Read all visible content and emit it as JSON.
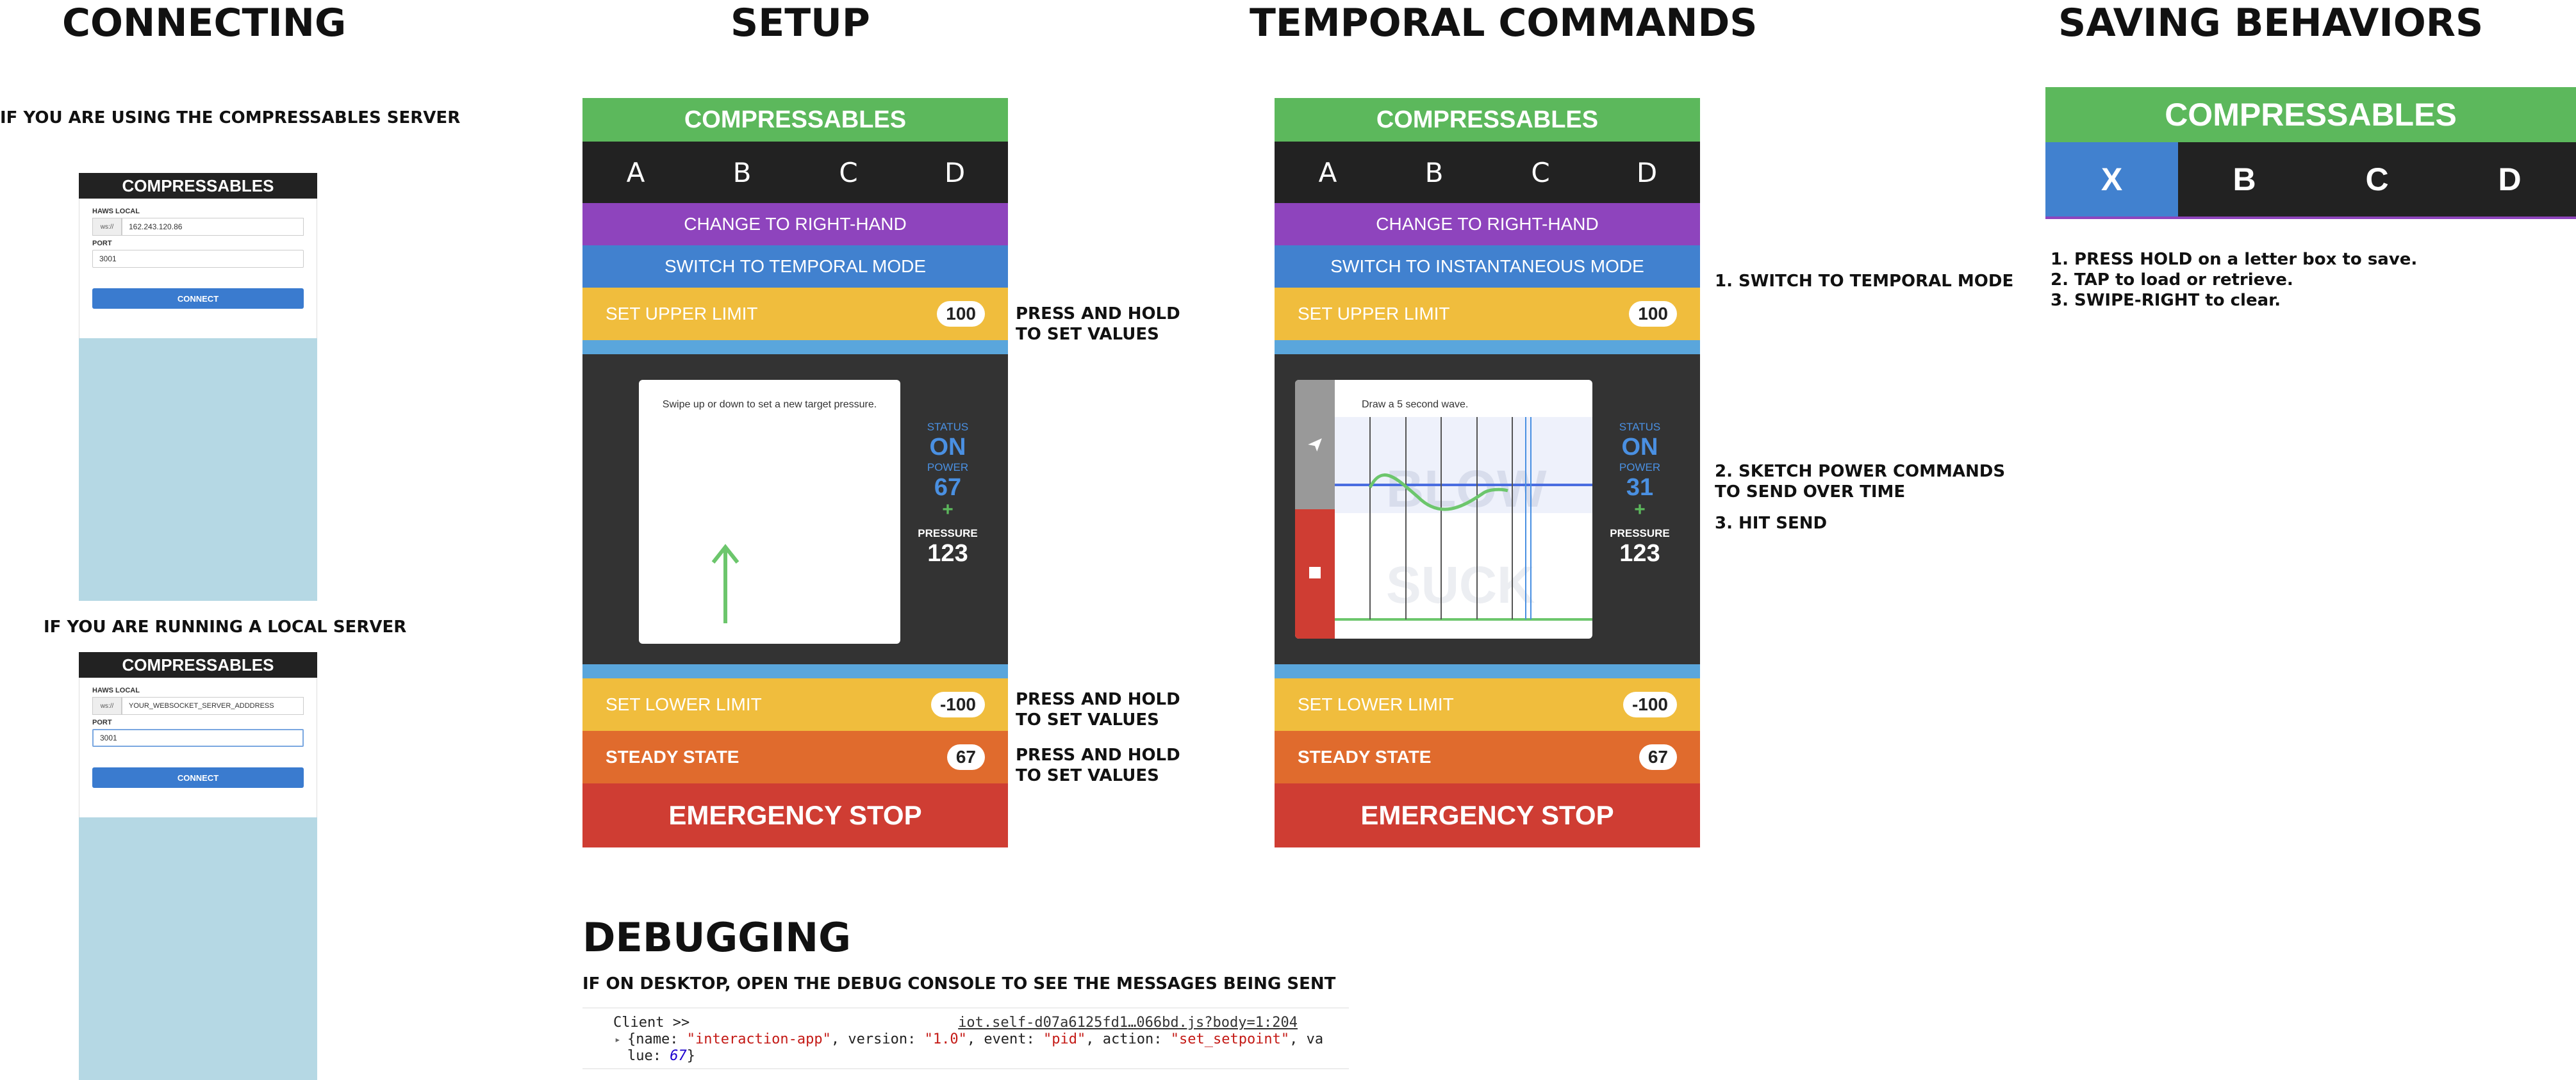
{
  "headings": {
    "connecting": "CONNECTING",
    "setup": "SETUP",
    "temporal": "TEMPORAL COMMANDS",
    "saving": "SAVING BEHAVIORS",
    "debugging": "DEBUGGING"
  },
  "connecting": {
    "server_note": "IF YOU ARE USING THE COMPRESSABLES SERVER",
    "local_note": "IF YOU ARE RUNNING A LOCAL SERVER",
    "phone1": {
      "title": "COMPRESSABLES",
      "haws_label": "HAWS LOCAL",
      "addon": "ws://",
      "host_value": "162.243.120.86",
      "port_label": "PORT",
      "port_value": "3001",
      "connect_label": "CONNECT"
    },
    "phone2": {
      "title": "COMPRESSABLES",
      "haws_label": "HAWS LOCAL",
      "addon": "ws://",
      "host_value": "YOUR_WEBSOCKET_SERVER_ADDDRESS",
      "port_label": "PORT",
      "port_value": "3001",
      "connect_label": "CONNECT"
    }
  },
  "setup": {
    "title": "COMPRESSABLES",
    "letters": [
      "A",
      "B",
      "C",
      "D"
    ],
    "change_hand": "CHANGE TO RIGHT-HAND",
    "mode_switch": "SWITCH TO TEMPORAL MODE",
    "upper_label": "SET UPPER LIMIT",
    "upper_value": "100",
    "instruction": "Swipe up or down to set a new target pressure.",
    "status_label": "STATUS",
    "status_value": "ON",
    "power_label": "POWER",
    "power_value": "67",
    "plus": "+",
    "pressure_label": "PRESSURE",
    "pressure_value": "123",
    "lower_label": "SET LOWER LIMIT",
    "lower_value": "-100",
    "steady_label": "STEADY STATE",
    "steady_value": "67",
    "stop_label": "EMERGENCY STOP",
    "note_upper": "PRESS AND HOLD TO SET VALUES",
    "note_lower": "PRESS AND HOLD TO SET VALUES",
    "note_steady": "PRESS AND HOLD TO SET VALUES"
  },
  "temporal": {
    "title": "COMPRESSABLES",
    "letters": [
      "A",
      "B",
      "C",
      "D"
    ],
    "change_hand": "CHANGE TO RIGHT-HAND",
    "mode_switch": "SWITCH TO INSTANTANEOUS MODE",
    "upper_label": "SET UPPER LIMIT",
    "upper_value": "100",
    "instruction": "Draw a 5 second wave.",
    "blow_label": "BLOW",
    "suck_label": "SUCK",
    "status_label": "STATUS",
    "status_value": "ON",
    "power_label": "POWER",
    "power_value": "31",
    "plus": "+",
    "pressure_label": "PRESSURE",
    "pressure_value": "123",
    "lower_label": "SET LOWER LIMIT",
    "lower_value": "-100",
    "steady_label": "STEADY STATE",
    "steady_value": "67",
    "stop_label": "EMERGENCY STOP",
    "step1": "1. SWITCH TO TEMPORAL MODE",
    "step2": "2. SKETCH POWER COMMANDS TO SEND OVER TIME",
    "step3": "3. HIT SEND"
  },
  "saving": {
    "title": "COMPRESSABLES",
    "letters": [
      "X",
      "B",
      "C",
      "D"
    ],
    "steps": [
      "1. PRESS HOLD on a letter box to save.",
      "2. TAP to load or retrieve.",
      "3. SWIPE-RIGHT to clear."
    ]
  },
  "debugging": {
    "note": "IF ON DESKTOP, OPEN THE DEBUG CONSOLE TO SEE THE MESSAGES BEING SENT",
    "client": "Client >>",
    "source_link": "iot.self-d07a6125fd1…066bd.js?body=1:204",
    "line1_open": "{name: ",
    "line1_name": "\"interaction-app\"",
    "line1_v": ", version: ",
    "line1_ver": "\"1.0\"",
    "line1_e": ", event: ",
    "line1_evt": "\"pid\"",
    "line1_a": ", action: ",
    "line1_act": "\"set_setpoint\"",
    "line1_tail": ", va",
    "line2_head": "lue: ",
    "line2_val": "67",
    "line2_close": "}"
  },
  "colors": {
    "green": "#5cb85c",
    "dark": "#222222",
    "purple": "#8e44bd",
    "blue": "#4181cf",
    "yellow": "#f0bd3d",
    "orange": "#e06b2d",
    "red": "#cf3d33",
    "light_blue": "#b5d8e4"
  }
}
